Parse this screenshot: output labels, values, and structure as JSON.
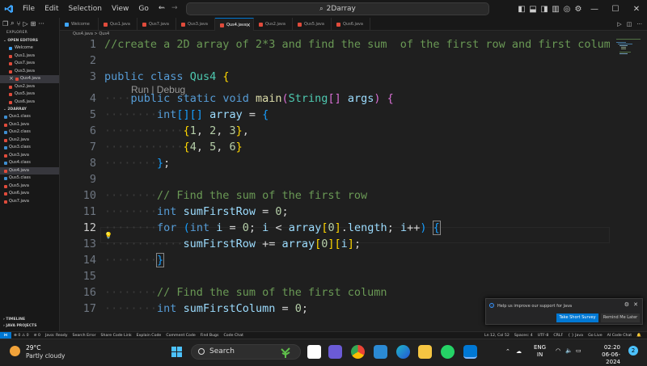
{
  "titlebar": {
    "menus": [
      "File",
      "Edit",
      "Selection",
      "View",
      "Go",
      "···"
    ],
    "search": "2Darray",
    "nav_back": "←",
    "nav_fwd": "→"
  },
  "sidebar": {
    "header": "EXPLORER",
    "open_editors_label": "OPEN EDITORS",
    "open_editors": [
      {
        "label": "Welcome",
        "type": "welcome"
      },
      {
        "label": "Qus1.java",
        "type": "java"
      },
      {
        "label": "Qus7.java",
        "type": "java"
      },
      {
        "label": "Qus3.java",
        "type": "java"
      },
      {
        "label": "Qus4.java",
        "type": "java",
        "selected": true,
        "close": true
      },
      {
        "label": "Qus2.java",
        "type": "java"
      },
      {
        "label": "Qus5.java",
        "type": "java"
      },
      {
        "label": "Qus6.java",
        "type": "java"
      }
    ],
    "folder_label": "2DARRAY",
    "files": [
      {
        "label": "Qus1.class",
        "type": "class"
      },
      {
        "label": "Qus1.java",
        "type": "java"
      },
      {
        "label": "Qus2.class",
        "type": "class"
      },
      {
        "label": "Qus2.java",
        "type": "java"
      },
      {
        "label": "Qus3.class",
        "type": "class"
      },
      {
        "label": "Qus3.java",
        "type": "java"
      },
      {
        "label": "Qus4.class",
        "type": "class"
      },
      {
        "label": "Qus4.java",
        "type": "java",
        "selected": true
      },
      {
        "label": "Qus5.class",
        "type": "class"
      },
      {
        "label": "Qus5.java",
        "type": "java"
      },
      {
        "label": "Qus6.java",
        "type": "java"
      },
      {
        "label": "Qus7.java",
        "type": "java"
      }
    ],
    "timeline": "TIMELINE",
    "java_projects": "JAVA PROJECTS"
  },
  "tabs": [
    {
      "label": "Welcome",
      "active": false
    },
    {
      "label": "Qus1.java",
      "active": false
    },
    {
      "label": "Qus7.java",
      "active": false
    },
    {
      "label": "Qus3.java",
      "active": false
    },
    {
      "label": "Qus4.java",
      "active": true
    },
    {
      "label": "Qus2.java",
      "active": false
    },
    {
      "label": "Qus5.java",
      "active": false
    },
    {
      "label": "Qus6.java",
      "active": false
    }
  ],
  "breadcrumb": "Qus4.java > Qus4",
  "editor": {
    "codelens": "Run | Debug",
    "current_line": 12,
    "lines": [
      {
        "n": 1,
        "html": "<span class='cm'>//create a 2D array of 2*3 and find the sum  of the first row and first column</span>"
      },
      {
        "n": 2,
        "html": ""
      },
      {
        "n": 3,
        "html": "<span class='kw'>public</span> <span class='kw'>class</span> <span class='ty'>Qus4</span> <span class='br'>{</span>"
      },
      {
        "n": 4,
        "html": "<span class='ws'>····</span><span class='kw'>public</span> <span class='kw'>static</span> <span class='kw'>void</span> <span class='fn'>main</span><span class='br2'>(</span><span class='ty'>String</span><span class='br2'>[]</span> <span class='vr'>args</span><span class='br2'>)</span> <span class='br2'>{</span>"
      },
      {
        "n": 5,
        "html": "<span class='ws'>········</span><span class='kw'>int</span><span class='br3'>[][]</span> <span class='vr'>array</span> = <span class='br3'>{</span>"
      },
      {
        "n": 6,
        "html": "<span class='ws'>············</span><span class='br'>{</span><span class='nm'>1</span>, <span class='nm'>2</span>, <span class='nm'>3</span><span class='br'>}</span>,"
      },
      {
        "n": 7,
        "html": "<span class='ws'>············</span><span class='br'>{</span><span class='nm'>4</span>, <span class='nm'>5</span>, <span class='nm'>6</span><span class='br'>}</span>"
      },
      {
        "n": 8,
        "html": "<span class='ws'>········</span><span class='br3'>}</span>;"
      },
      {
        "n": 9,
        "html": ""
      },
      {
        "n": 10,
        "html": "<span class='ws'>········</span><span class='cm'>// Find the sum of the first row</span>"
      },
      {
        "n": 11,
        "html": "<span class='ws'>········</span><span class='kw'>int</span> <span class='vr'>sumFirstRow</span> = <span class='nm'>0</span>;"
      },
      {
        "n": 12,
        "html": "<span class='ws'>········</span><span class='kw'>for</span> <span class='br3'>(</span><span class='kw'>int</span> <span class='vr'>i</span> = <span class='nm'>0</span>; <span class='vr'>i</span> &lt; <span class='vr'>array</span><span class='br'>[</span><span class='nm'>0</span><span class='br'>]</span>.<span class='vr'>length</span>; <span class='vr'>i</span>++<span class='br3'>)</span> <span class='br3' style='outline:1px solid #888'>{</span>"
      },
      {
        "n": 13,
        "html": "<span class='ws'>············</span><span class='vr'>sumFirstRow</span> += <span class='vr'>array</span><span class='br'>[</span><span class='nm'>0</span><span class='br'>][</span><span class='vr'>i</span><span class='br'>]</span>;"
      },
      {
        "n": 14,
        "html": "<span class='ws'>········</span><span class='br3' style='outline:1px solid #888'>}</span>"
      },
      {
        "n": 15,
        "html": ""
      },
      {
        "n": 16,
        "html": "<span class='ws'>········</span><span class='cm'>// Find the sum of the first column</span>"
      },
      {
        "n": 17,
        "html": "<span class='ws'>········</span><span class='kw'>int</span> <span class='vr'>sumFirstColumn</span> = <span class='nm'>0</span>;"
      }
    ]
  },
  "notification": {
    "message": "Help us improve our support for Java",
    "primary": "Take Short Survey",
    "secondary": "Remind Me Later"
  },
  "statusbar": {
    "left": [
      "⊗ 0 ⚠ 0",
      "⊘ 0",
      "Java: Ready",
      "Search Error",
      "Share Code Link",
      "Explain Code",
      "Comment Code",
      "Find Bugs",
      "Code Chat"
    ],
    "right": [
      "Ln 12, Col 52",
      "Spaces: 4",
      "UTF-8",
      "CRLF",
      "{ } Java",
      "Go Live",
      "AI Code Chat"
    ]
  },
  "taskbar": {
    "temp": "29°C",
    "weather": "Partly cloudy",
    "search": "Search",
    "lang1": "ENG",
    "lang2": "IN",
    "time": "02:20",
    "date": "06-06-2024",
    "badge": "2"
  },
  "colors": {
    "accent": "#0078d4",
    "java_icon": "#e04b3b",
    "bg": "#1f1f1f"
  }
}
